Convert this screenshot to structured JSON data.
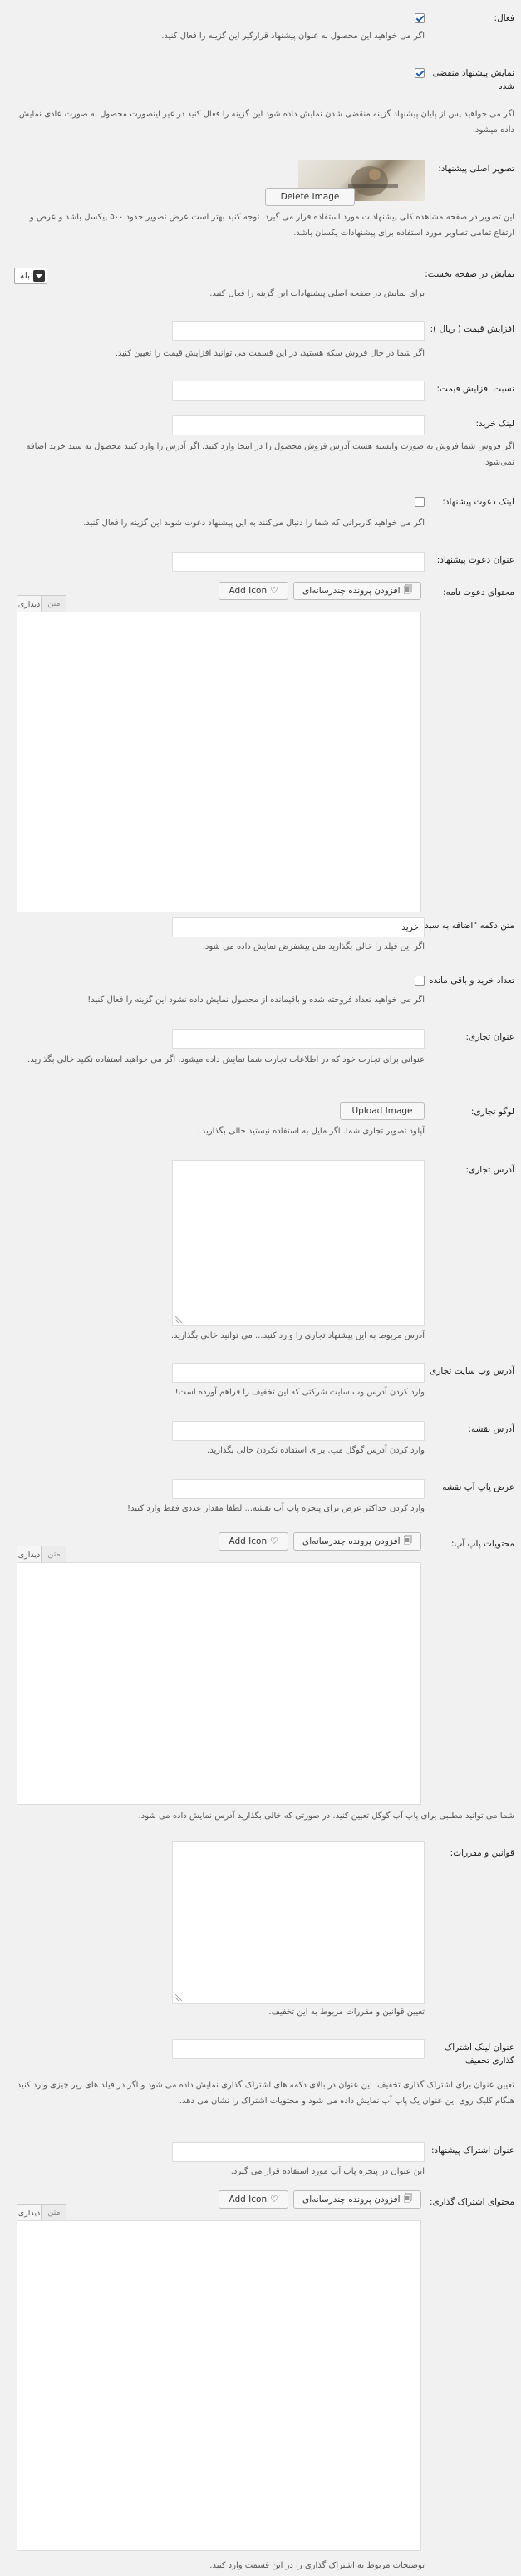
{
  "fields": {
    "active": {
      "label": "فعال:",
      "checked": true,
      "desc": "اگر می خواهید این محصول به عنوان پیشنهاد قرارگیر این گزینه را فعال کنید."
    },
    "show_expired": {
      "label": "نمایش پیشنهاد منقضی شده",
      "checked": true,
      "desc": "اگر می خواهید پس از پایان پیشنهاد گزینه منقضی شدن نمایش داده شود این گزینه را فعال کنید در غیر اینصورت محصول به صورت عادی نمایش داده میشود."
    },
    "main_image": {
      "label": "تصویر اصلی پیشنهاد:",
      "button": "Delete Image",
      "desc": "این تصویر در صفحه مشاهده کلی پیشنهادات مورد استفاده قرار می گیرد. توجه کنید بهتر است عرض تصویر حدود ۵۰۰ پیکسل باشد و عرض و ارتفاع تمامی تصاویر مورد استفاده برای پیشنهادات یکسان باشد."
    },
    "show_home": {
      "label": "نمایش در صفحه نخست:",
      "select": "بله",
      "desc": "برای نمایش در صفحه اصلی پیشنهادات این گزینه را فعال کنید."
    },
    "price_increase": {
      "label": "افزایش قیمت ( ریال ):",
      "value": "",
      "desc": "اگر شما در حال فروش سکه هستید، در این قسمت می توانید افزایش قیمت را تعیین کنید."
    },
    "price_ratio": {
      "label": "نسبت افزایش قیمت:",
      "value": ""
    },
    "buy_link": {
      "label": "لینک خرید:",
      "value": "",
      "desc": "اگر فروش شما فروش به صورت وابسته هست آدرس فروش محصول را در اینجا وارد کنید. اگر آدرس را وارد کنید محصول به سبد خرید اضافه نمی‌شود."
    },
    "invite_link": {
      "label": "لینک دعوت پیشنهاد:",
      "checked": false,
      "desc": "اگر می خواهید کاربرانی که شما را دنبال می‌کنند به این پیشنهاد دعوت شوند این گزینه را فعال کنید."
    },
    "invite_title": {
      "label": "عنوان دعوت پیشنهاد:",
      "value": ""
    },
    "invite_content": {
      "label": "محتوای دعوت نامه:"
    },
    "add_to_cart_text": {
      "label": "متن دکمه \"اضافه به سبد\":",
      "value": "خرید",
      "desc": "اگر این فیلد را خالی بگذارید متن پیشفرض نمایش داده می شود."
    },
    "sold_count": {
      "label": "تعداد خرید و باقی مانده",
      "checked": false,
      "desc": "اگر می خواهید تعداد فروخته شده و باقیمانده از محصول نمایش داده نشود این گزینه را فعال کنید!"
    },
    "business_title": {
      "label": "عنوان تجاری:",
      "value": "",
      "desc": "عنوانی برای تجارت خود که در اطلاعات تجارت شما نمایش داده میشود. اگر می خواهید استفاده نکنید خالی بگذارید."
    },
    "business_logo": {
      "label": "لوگو تجاری:",
      "button": "Upload Image",
      "desc": "آپلود تصویر تجاری شما. اگر مایل به استفاده نیستید خالی بگذارید."
    },
    "business_address": {
      "label": "آدرس تجاری:",
      "desc": "آدرس مربوط به این پیشنهاد تجاری را وارد کنید... می توانید خالی بگذارید."
    },
    "business_website": {
      "label": "آدرس وب سایت تجاری",
      "value": "",
      "desc": "وارد کردن آدرس وب سایت شرکتی که این تخفیف را فراهم آورده است!"
    },
    "map_address": {
      "label": "آدرس نقشه:",
      "value": "",
      "desc": "وارد کردن آدرس گوگل مپ. برای استفاده نکردن خالی بگذارید."
    },
    "map_popup_width": {
      "label": "عرض پاپ آپ نقشه",
      "value": "",
      "desc": "وارد کردن حداکثر عرض برای پنجره پاپ آپ نقشه... لطفا مقدار عددی فقط وارد کنید!"
    },
    "popup_content": {
      "label": "محتویات پاپ آپ:",
      "desc": "شما می توانید مطلبی برای پاپ آپ گوگل تعیین کنید. در صورتی که خالی بگذارید آدرس نمایش داده می شود."
    },
    "terms": {
      "label": "قوانین و مقررات:",
      "desc": "تعیین قوانین و مقررات مربوط به این تخفیف."
    },
    "share_link_title": {
      "label": "عنوان لینک اشتراک گذاری تخفیف",
      "value": "",
      "desc": "تعیین عنوان برای اشتراک گذاری تخفیف. این عنوان در بالای دکمه های اشتراک گذاری نمایش داده می شود و اگر در فیلد های زیر چیزی وارد کنید هنگام کلیک روی این عنوان یک پاپ آپ نمایش داده می شود و محتویات اشتراک را نشان می دهد."
    },
    "share_title": {
      "label": "عنوان اشتراک پیشنهاد:",
      "value": "",
      "desc": "این عنوان در پنجره پاپ آپ مورد استفاده قرار می گیرد."
    },
    "share_content": {
      "label": "محتوای اشتراک گذاری:",
      "desc": "توضیحات مربوط به اشتراک گذاری را در این قسمت وارد کنید."
    }
  },
  "editor": {
    "add_media": "افزودن پرونده چندرسانه‌ای",
    "add_icon": "Add Icon",
    "tab_visual": "دیداری",
    "tab_text": "متن"
  },
  "colors": {
    "accent": "#1e5aa8",
    "background": "#f1f1f1",
    "field_border": "#dddddd"
  }
}
